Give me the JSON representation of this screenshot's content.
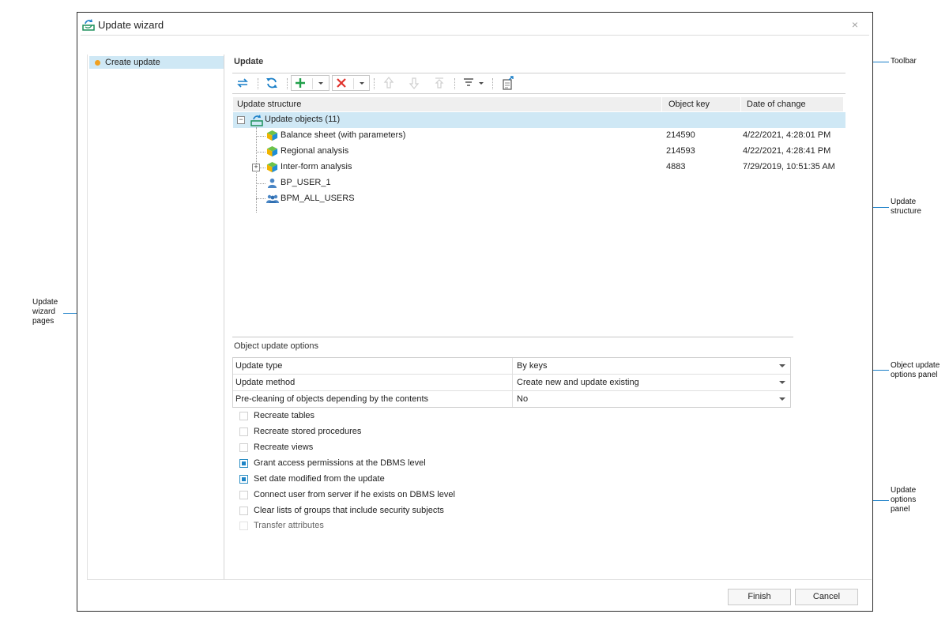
{
  "window": {
    "title": "Update wizard",
    "close_glyph": "×"
  },
  "wizard_pages": [
    {
      "label": "Create update",
      "active": true
    }
  ],
  "update_section": {
    "title": "Update"
  },
  "toolbar": {
    "buttons": [
      "update-refresh-icon",
      "refresh-icon",
      "add-icon",
      "dropdown-arrow-icon",
      "delete-icon",
      "dropdown-arrow-icon",
      "move-up-icon",
      "move-down-icon",
      "move-top-icon",
      "filter-icon",
      "dropdown-arrow-icon",
      "export-icon"
    ]
  },
  "tree": {
    "columns": [
      "Update structure",
      "Object key",
      "Date of change"
    ],
    "root": {
      "label": "Update objects (11)",
      "expanded": true
    },
    "rows": [
      {
        "label": "Balance sheet (with parameters)",
        "key": "214590",
        "date": "4/22/2021, 4:28:01 PM",
        "icon": "cube-icon"
      },
      {
        "label": "Regional analysis",
        "key": "214593",
        "date": "4/22/2021, 4:28:41 PM",
        "icon": "cube-icon"
      },
      {
        "label": "Inter-form analysis",
        "key": "4883",
        "date": "7/29/2019, 10:51:35 AM",
        "icon": "cube-icon",
        "expandable": true
      },
      {
        "label": "BP_USER_1",
        "key": "",
        "date": "",
        "icon": "user-icon"
      },
      {
        "label": "BPM_ALL_USERS",
        "key": "",
        "date": "",
        "icon": "group-icon"
      }
    ]
  },
  "object_options": {
    "title": "Object update options",
    "rows": [
      {
        "name": "Update type",
        "value": "By keys"
      },
      {
        "name": "Update method",
        "value": "Create new and update existing"
      },
      {
        "name": "Pre-cleaning of objects depending by the contents",
        "value": "No"
      }
    ]
  },
  "update_options": [
    {
      "label": "Recreate tables",
      "checked": false,
      "enabled": true
    },
    {
      "label": "Recreate stored procedures",
      "checked": false,
      "enabled": true
    },
    {
      "label": "Recreate views",
      "checked": false,
      "enabled": true
    },
    {
      "label": "Grant access permissions at the DBMS level",
      "checked": true,
      "enabled": true
    },
    {
      "label": "Set date modified from the update",
      "checked": true,
      "enabled": true
    },
    {
      "label": "Connect user from server if he exists on DBMS level",
      "checked": false,
      "enabled": true
    },
    {
      "label": "Clear lists of groups that include security subjects",
      "checked": false,
      "enabled": true
    },
    {
      "label": "Transfer attributes",
      "checked": false,
      "enabled": false
    }
  ],
  "buttons": {
    "finish": "Finish",
    "cancel": "Cancel"
  },
  "callouts": {
    "toolbar": "Toolbar",
    "update_structure": "Update\nstructure",
    "wizard_pages": "Update\nwizard\npages",
    "object_options": "Object update\noptions panel",
    "update_options": "Update\noptions\npanel"
  },
  "colors": {
    "accent": "#1a7fc8",
    "selection": "#cfe8f5",
    "cube_green": "#3aa84a",
    "cube_blue": "#1f8ed6"
  }
}
